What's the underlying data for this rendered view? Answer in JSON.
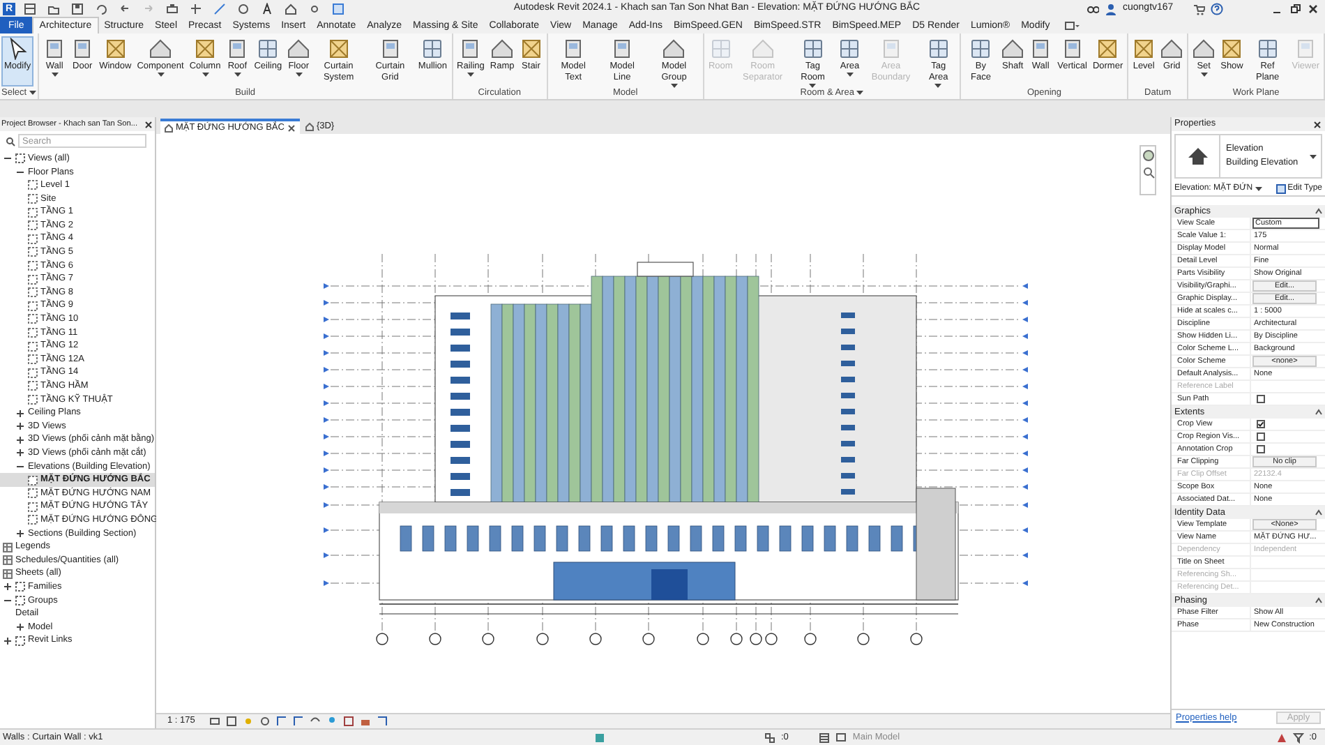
{
  "title_bar": {
    "app_letter": "R",
    "title": "Autodesk Revit 2024.1 - Khach san Tan Son Nhat Ban - Elevation: MẶT ĐỨNG HƯỚNG BẮC",
    "user": "cuongtv167"
  },
  "ribbon": {
    "tabs": [
      {
        "label": "File",
        "kind": "file",
        "selected": false
      },
      {
        "label": "Architecture",
        "kind": "tab",
        "selected": true
      },
      {
        "label": "Structure",
        "kind": "tab",
        "selected": false
      },
      {
        "label": "Steel",
        "kind": "tab",
        "selected": false
      },
      {
        "label": "Precast",
        "kind": "tab",
        "selected": false
      },
      {
        "label": "Systems",
        "kind": "tab",
        "selected": false
      },
      {
        "label": "Insert",
        "kind": "tab",
        "selected": false
      },
      {
        "label": "Annotate",
        "kind": "tab",
        "selected": false
      },
      {
        "label": "Analyze",
        "kind": "tab",
        "selected": false
      },
      {
        "label": "Massing & Site",
        "kind": "tab",
        "selected": false
      },
      {
        "label": "Collaborate",
        "kind": "tab",
        "selected": false
      },
      {
        "label": "View",
        "kind": "tab",
        "selected": false
      },
      {
        "label": "Manage",
        "kind": "tab",
        "selected": false
      },
      {
        "label": "Add-Ins",
        "kind": "tab",
        "selected": false
      },
      {
        "label": "BimSpeed.GEN",
        "kind": "tab",
        "selected": false
      },
      {
        "label": "BimSpeed.STR",
        "kind": "tab",
        "selected": false
      },
      {
        "label": "BimSpeed.MEP",
        "kind": "tab",
        "selected": false
      },
      {
        "label": "D5 Render",
        "kind": "tab",
        "selected": false
      },
      {
        "label": "Lumion®",
        "kind": "tab",
        "selected": false
      },
      {
        "label": "Modify",
        "kind": "tab",
        "selected": false
      }
    ],
    "panels": [
      {
        "label": "Select",
        "has_menu": true,
        "buttons": [
          {
            "label": "Modify",
            "selected": true,
            "disabled": false,
            "dropdown": false
          }
        ]
      },
      {
        "label": "Build",
        "has_menu": false,
        "buttons": [
          {
            "label": "Wall",
            "selected": false,
            "disabled": false,
            "dropdown": true
          },
          {
            "label": "Door",
            "selected": false,
            "disabled": false,
            "dropdown": false
          },
          {
            "label": "Window",
            "selected": false,
            "disabled": false,
            "dropdown": false
          },
          {
            "label": "Component",
            "selected": false,
            "disabled": false,
            "dropdown": true
          },
          {
            "label": "Column",
            "selected": false,
            "disabled": false,
            "dropdown": true
          },
          {
            "label": "Roof",
            "selected": false,
            "disabled": false,
            "dropdown": true
          },
          {
            "label": "Ceiling",
            "selected": false,
            "disabled": false,
            "dropdown": false
          },
          {
            "label": "Floor",
            "selected": false,
            "disabled": false,
            "dropdown": true
          },
          {
            "label": "Curtain System",
            "selected": false,
            "disabled": false,
            "dropdown": false
          },
          {
            "label": "Curtain Grid",
            "selected": false,
            "disabled": false,
            "dropdown": false
          },
          {
            "label": "Mullion",
            "selected": false,
            "disabled": false,
            "dropdown": false
          }
        ]
      },
      {
        "label": "Circulation",
        "has_menu": false,
        "buttons": [
          {
            "label": "Railing",
            "selected": false,
            "disabled": false,
            "dropdown": true
          },
          {
            "label": "Ramp",
            "selected": false,
            "disabled": false,
            "dropdown": false
          },
          {
            "label": "Stair",
            "selected": false,
            "disabled": false,
            "dropdown": false
          }
        ]
      },
      {
        "label": "Model",
        "has_menu": false,
        "buttons": [
          {
            "label": "Model Text",
            "selected": false,
            "disabled": false,
            "dropdown": false
          },
          {
            "label": "Model Line",
            "selected": false,
            "disabled": false,
            "dropdown": false
          },
          {
            "label": "Model Group",
            "selected": false,
            "disabled": false,
            "dropdown": true
          }
        ]
      },
      {
        "label": "Room & Area",
        "has_menu": true,
        "buttons": [
          {
            "label": "Room",
            "selected": false,
            "disabled": true,
            "dropdown": false
          },
          {
            "label": "Room Separator",
            "selected": false,
            "disabled": true,
            "dropdown": false
          },
          {
            "label": "Tag Room",
            "selected": false,
            "disabled": false,
            "dropdown": true
          },
          {
            "label": "Area",
            "selected": false,
            "disabled": false,
            "dropdown": true
          },
          {
            "label": "Area Boundary",
            "selected": false,
            "disabled": true,
            "dropdown": false
          },
          {
            "label": "Tag Area",
            "selected": false,
            "disabled": false,
            "dropdown": true
          }
        ]
      },
      {
        "label": "Opening",
        "has_menu": false,
        "buttons": [
          {
            "label": "By Face",
            "selected": false,
            "disabled": false,
            "dropdown": false
          },
          {
            "label": "Shaft",
            "selected": false,
            "disabled": false,
            "dropdown": false
          },
          {
            "label": "Wall",
            "selected": false,
            "disabled": false,
            "dropdown": false
          },
          {
            "label": "Vertical",
            "selected": false,
            "disabled": false,
            "dropdown": false
          },
          {
            "label": "Dormer",
            "selected": false,
            "disabled": false,
            "dropdown": false
          }
        ]
      },
      {
        "label": "Datum",
        "has_menu": false,
        "buttons": [
          {
            "label": "Level",
            "selected": false,
            "disabled": false,
            "dropdown": false
          },
          {
            "label": "Grid",
            "selected": false,
            "disabled": false,
            "dropdown": false
          }
        ]
      },
      {
        "label": "Work Plane",
        "has_menu": false,
        "buttons": [
          {
            "label": "Set",
            "selected": false,
            "disabled": false,
            "dropdown": true
          },
          {
            "label": "Show",
            "selected": false,
            "disabled": false,
            "dropdown": false
          },
          {
            "label": "Ref Plane",
            "selected": false,
            "disabled": false,
            "dropdown": false
          },
          {
            "label": "Viewer",
            "selected": false,
            "disabled": true,
            "dropdown": false
          }
        ]
      }
    ]
  },
  "project_browser": {
    "title": "Project Browser - Khach san Tan Son...",
    "search": {
      "placeholder": "Search"
    },
    "tree": [
      {
        "label": "Views (all)",
        "kind": "root",
        "expanded": true,
        "selected": false,
        "children": [
          {
            "label": "Floor Plans",
            "kind": "category",
            "expanded": true,
            "selected": false,
            "children": [
              {
                "label": "Level 1",
                "kind": "view",
                "selected": false
              },
              {
                "label": "Site",
                "kind": "view",
                "selected": false
              },
              {
                "label": "TẦNG 1",
                "kind": "view",
                "selected": false
              },
              {
                "label": "TẦNG 2",
                "kind": "view",
                "selected": false
              },
              {
                "label": "TẦNG 4",
                "kind": "view",
                "selected": false
              },
              {
                "label": "TẦNG 5",
                "kind": "view",
                "selected": false
              },
              {
                "label": "TẦNG 6",
                "kind": "view",
                "selected": false
              },
              {
                "label": "TẦNG 7",
                "kind": "view",
                "selected": false
              },
              {
                "label": "TẦNG 8",
                "kind": "view",
                "selected": false
              },
              {
                "label": "TẦNG 9",
                "kind": "view",
                "selected": false
              },
              {
                "label": "TẦNG 10",
                "kind": "view",
                "selected": false
              },
              {
                "label": "TẦNG 11",
                "kind": "view",
                "selected": false
              },
              {
                "label": "TẦNG 12",
                "kind": "view",
                "selected": false
              },
              {
                "label": "TẦNG 12A",
                "kind": "view",
                "selected": false
              },
              {
                "label": "TẦNG 14",
                "kind": "view",
                "selected": false
              },
              {
                "label": "TẦNG HẦM",
                "kind": "view",
                "selected": false
              },
              {
                "label": "TẦNG KỸ THUẬT",
                "kind": "view",
                "selected": false
              }
            ]
          },
          {
            "label": "Ceiling Plans",
            "kind": "category",
            "expanded": false,
            "selected": false
          },
          {
            "label": "3D Views",
            "kind": "category",
            "expanded": false,
            "selected": false
          },
          {
            "label": "3D Views (phối cảnh mặt bằng)",
            "kind": "category",
            "expanded": false,
            "selected": false
          },
          {
            "label": "3D Views (phối cảnh mặt cắt)",
            "kind": "category",
            "expanded": false,
            "selected": false
          },
          {
            "label": "Elevations (Building Elevation)",
            "kind": "category",
            "expanded": true,
            "selected": false,
            "children": [
              {
                "label": "MẶT ĐỨNG HƯỚNG BẮC",
                "kind": "view",
                "selected": true
              },
              {
                "label": "MẶT ĐỨNG HƯỚNG NAM",
                "kind": "view",
                "selected": false
              },
              {
                "label": "MẶT ĐỨNG HƯỚNG TÂY",
                "kind": "view",
                "selected": false
              },
              {
                "label": "MẶT ĐỨNG HƯỚNG ĐÔNG",
                "kind": "view",
                "selected": false
              }
            ]
          },
          {
            "label": "Sections (Building Section)",
            "kind": "category",
            "expanded": false,
            "selected": false
          }
        ]
      },
      {
        "label": "Legends",
        "kind": "list",
        "selected": false
      },
      {
        "label": "Schedules/Quantities (all)",
        "kind": "list",
        "selected": false
      },
      {
        "label": "Sheets (all)",
        "kind": "list",
        "selected": false
      },
      {
        "label": "Families",
        "kind": "root",
        "expanded": false,
        "selected": false
      },
      {
        "label": "Groups",
        "kind": "root",
        "expanded": true,
        "selected": false,
        "children": [
          {
            "label": "Detail",
            "kind": "plain",
            "selected": false
          },
          {
            "label": "Model",
            "kind": "category",
            "expanded": false,
            "selected": false
          }
        ]
      },
      {
        "label": "Revit Links",
        "kind": "root",
        "expanded": false,
        "selected": false
      }
    ]
  },
  "view_tabs": [
    {
      "label": "MẶT ĐỨNG HƯỚNG BẮC",
      "selected": true
    },
    {
      "label": "{3D}",
      "selected": false
    }
  ],
  "view_control_bar": {
    "scale": "1 : 175"
  },
  "properties": {
    "title": "Properties",
    "type_name": "Elevation",
    "type_subname": "Building Elevation",
    "selector": "Elevation: MẶT ĐỨN",
    "edit_type": "Edit Type",
    "groups": [
      {
        "label": "Graphics",
        "rows": [
          {
            "label": "View Scale",
            "value": "Custom",
            "kind": "field",
            "disabled": false
          },
          {
            "label": "Scale Value 1:",
            "value": "175",
            "kind": "text",
            "disabled": false
          },
          {
            "label": "Display Model",
            "value": "Normal",
            "kind": "text",
            "disabled": false
          },
          {
            "label": "Detail Level",
            "value": "Fine",
            "kind": "text",
            "disabled": false
          },
          {
            "label": "Parts Visibility",
            "value": "Show Original",
            "kind": "text",
            "disabled": false
          },
          {
            "label": "Visibility/Graphi...",
            "value": "Edit...",
            "kind": "button",
            "disabled": false
          },
          {
            "label": "Graphic Display...",
            "value": "Edit...",
            "kind": "button",
            "disabled": false
          },
          {
            "label": "Hide at scales c...",
            "value": "1 : 5000",
            "kind": "text",
            "disabled": false
          },
          {
            "label": "Discipline",
            "value": "Architectural",
            "kind": "text",
            "disabled": false
          },
          {
            "label": "Show Hidden Li...",
            "value": "By Discipline",
            "kind": "text",
            "disabled": false
          },
          {
            "label": "Color Scheme L...",
            "value": "Background",
            "kind": "text",
            "disabled": false
          },
          {
            "label": "Color Scheme",
            "value": "<none>",
            "kind": "button",
            "disabled": false
          },
          {
            "label": "Default Analysis...",
            "value": "None",
            "kind": "text",
            "disabled": false
          },
          {
            "label": "Reference Label",
            "kind": "text",
            "disabled": true
          },
          {
            "label": "Sun Path",
            "kind": "checkbox",
            "checked": false,
            "disabled": false
          }
        ]
      },
      {
        "label": "Extents",
        "rows": [
          {
            "label": "Crop View",
            "kind": "checkbox",
            "checked": true,
            "disabled": false
          },
          {
            "label": "Crop Region Vis...",
            "kind": "checkbox",
            "checked": false,
            "disabled": false
          },
          {
            "label": "Annotation Crop",
            "kind": "checkbox",
            "checked": false,
            "disabled": false
          },
          {
            "label": "Far Clipping",
            "value": "No clip",
            "kind": "button",
            "disabled": false
          },
          {
            "label": "Far Clip Offset",
            "value": "22132.4",
            "kind": "text",
            "disabled": true
          },
          {
            "label": "Scope Box",
            "value": "None",
            "kind": "text",
            "disabled": false
          },
          {
            "label": "Associated Dat...",
            "value": "None",
            "kind": "text",
            "disabled": false
          }
        ]
      },
      {
        "label": "Identity Data",
        "rows": [
          {
            "label": "View Template",
            "value": "<None>",
            "kind": "button",
            "disabled": false
          },
          {
            "label": "View Name",
            "value": "MẶT ĐỨNG HƯ...",
            "kind": "text",
            "disabled": false
          },
          {
            "label": "Dependency",
            "value": "Independent",
            "kind": "text",
            "disabled": true
          },
          {
            "label": "Title on Sheet",
            "kind": "text",
            "disabled": false
          },
          {
            "label": "Referencing Sh...",
            "kind": "text",
            "disabled": true
          },
          {
            "label": "Referencing Det...",
            "kind": "text",
            "disabled": true
          }
        ]
      },
      {
        "label": "Phasing",
        "rows": [
          {
            "label": "Phase Filter",
            "value": "Show All",
            "kind": "text",
            "disabled": false
          },
          {
            "label": "Phase",
            "value": "New Construction",
            "kind": "text",
            "disabled": false
          }
        ]
      }
    ],
    "help_link": "Properties help",
    "apply": {
      "label": "Apply",
      "disabled": true
    }
  },
  "status_bar": {
    "message": "Walls : Curtain Wall : vk1",
    "workset_count": ":0",
    "model": "Main Model",
    "filter_count": ":0"
  }
}
